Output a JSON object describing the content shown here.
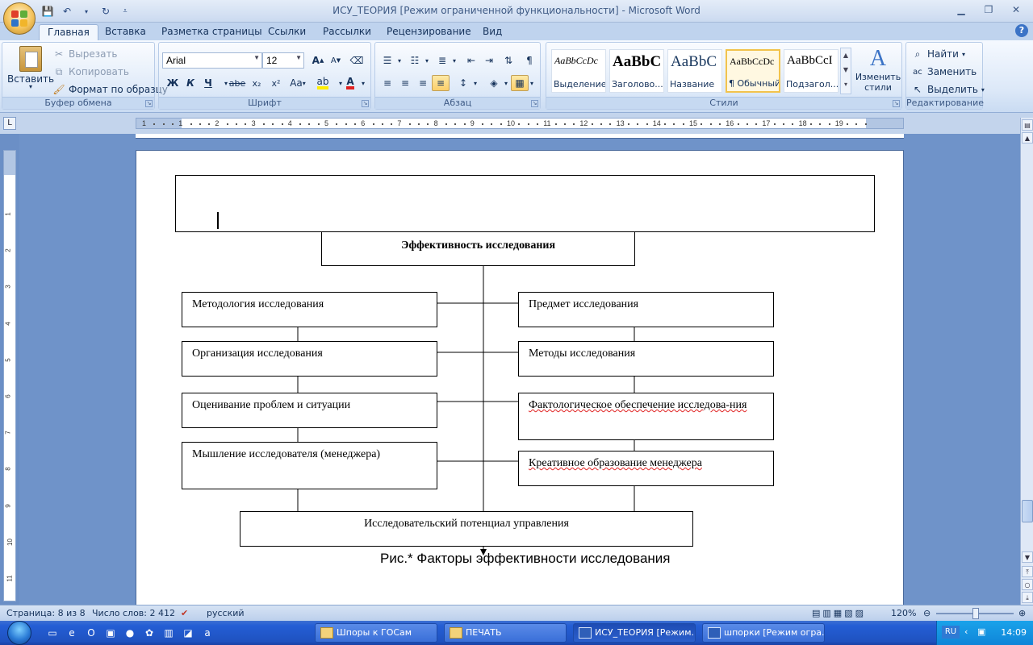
{
  "window": {
    "title": "ИСУ_ТЕОРИЯ [Режим ограниченной функциональности] - Microsoft Word"
  },
  "tabs": [
    "Главная",
    "Вставка",
    "Разметка страницы",
    "Ссылки",
    "Рассылки",
    "Рецензирование",
    "Вид"
  ],
  "ribbon": {
    "clipboard": {
      "label": "Буфер обмена",
      "paste": "Вставить",
      "cut": "Вырезать",
      "copy": "Копировать",
      "format_painter": "Формат по образцу"
    },
    "font": {
      "label": "Шрифт",
      "family": "Arial",
      "size": "12",
      "bold": "Ж",
      "italic": "К",
      "underline": "Ч",
      "strike": "abe",
      "subscript": "x₂",
      "superscript": "x²",
      "case": "Aa",
      "grow": "A",
      "shrink": "A"
    },
    "paragraph": {
      "label": "Абзац"
    },
    "styles": {
      "label": "Стили",
      "items": [
        {
          "sample": "AaBbCcDc",
          "name": "Выделение"
        },
        {
          "sample": "AaBbC",
          "name": "Заголово..."
        },
        {
          "sample": "AaBbC",
          "name": "Название"
        },
        {
          "sample": "AaBbCcDc",
          "name": "¶ Обычный"
        },
        {
          "sample": "AaBbCcI",
          "name": "Подзагол..."
        }
      ],
      "change_styles": "Изменить стили"
    },
    "editing": {
      "label": "Редактирование",
      "find": "Найти",
      "replace": "Заменить",
      "select": "Выделить"
    }
  },
  "ruler": {
    "ticks": [
      "1",
      "1",
      "2",
      "3",
      "4",
      "5",
      "6",
      "7",
      "8",
      "9",
      "10",
      "11",
      "12",
      "13",
      "14",
      "15",
      "16",
      "17",
      "18",
      "19"
    ],
    "vticks": [
      "1",
      "2",
      "3",
      "4",
      "5",
      "6",
      "7",
      "8",
      "9",
      "10",
      "11"
    ]
  },
  "diagram": {
    "top": "Эффективность исследования",
    "left": [
      "Методология исследования",
      "Организация исследования",
      "Оценивание проблем и ситуации",
      "Мышление исследователя (менеджера)"
    ],
    "right": [
      "Предмет исследования",
      "Методы исследования",
      "Фактологическое обеспечение исследова-ния",
      "Креативное образование менеджера"
    ],
    "bottom": "Исследовательский потенциал управления",
    "caption": "Рис.* Факторы эффективности исследования"
  },
  "status": {
    "page": "Страница: 8 из 8",
    "words": "Число слов: 2 412",
    "language": "русский",
    "zoom": "120%"
  },
  "taskbar": {
    "tasks": [
      "Шпоры к ГОСам",
      "ПЕЧАТЬ",
      "ИСУ_ТЕОРИЯ [Режим...",
      "шпорки [Режим огра..."
    ],
    "lang": "RU",
    "clock": "14:09"
  }
}
